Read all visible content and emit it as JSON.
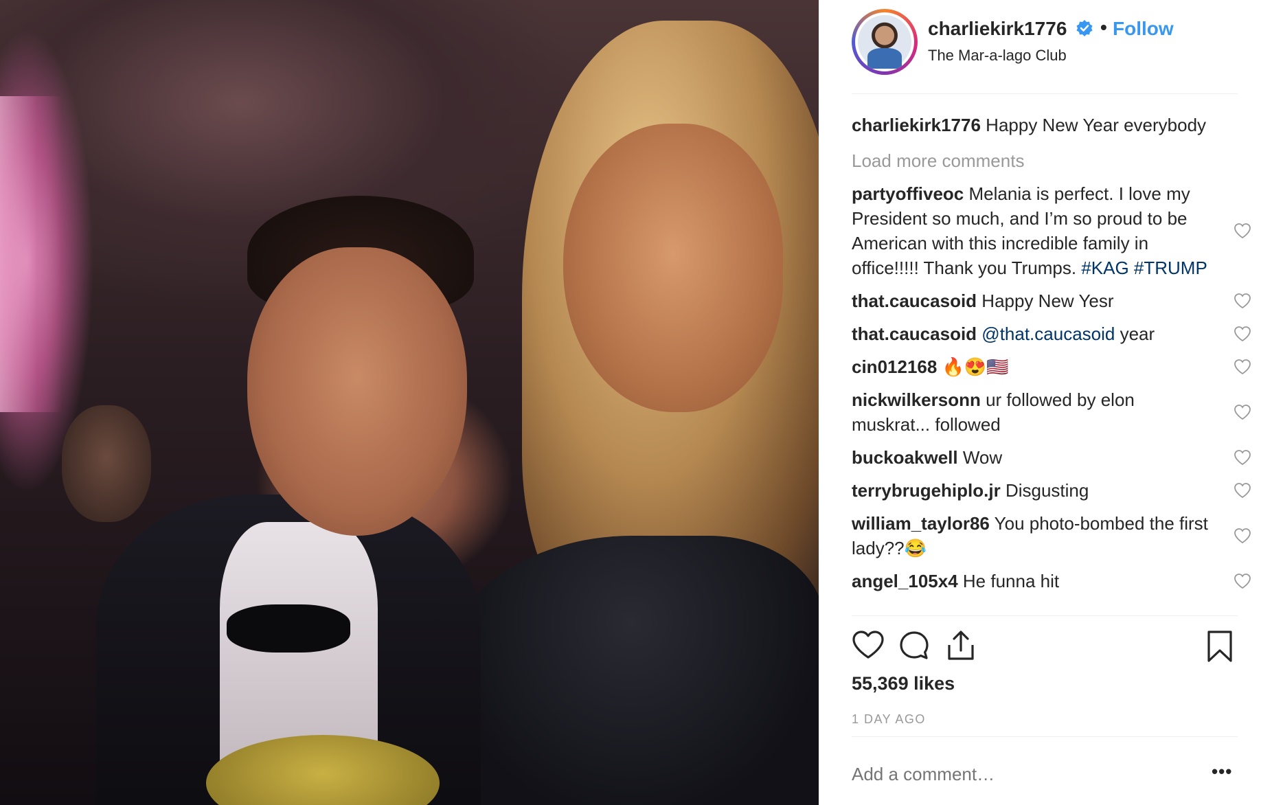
{
  "post": {
    "photo_alt": "",
    "header": {
      "username": "charliekirk1776",
      "dot": "•",
      "follow_label": "Follow",
      "location": "The Mar-a-lago Club"
    },
    "caption": {
      "username": "charliekirk1776",
      "text": "Happy New Year everybody"
    },
    "load_more_label": "Load more comments",
    "comments": [
      {
        "user": "partyoffiveoc",
        "text": "Melania is perfect. I love my President so much, and I’m so proud to be American with this incredible family in office!!!!! Thank you Trumps. ",
        "tags": "#KAG #TRUMP"
      },
      {
        "user": "that.caucasoid",
        "text": "Happy New Yesr",
        "tags": ""
      },
      {
        "user": "that.caucasoid",
        "mention": "@that.caucasoid",
        "text": " year",
        "tags": ""
      },
      {
        "user": "cin012168",
        "text": "🔥😍🇺🇸",
        "tags": ""
      },
      {
        "user": "nickwilkersonn",
        "text": "ur followed by elon muskrat... followed",
        "tags": ""
      },
      {
        "user": "buckoakwell",
        "text": "Wow",
        "tags": ""
      },
      {
        "user": "terrybrugehiplo.jr",
        "text": "Disgusting",
        "tags": ""
      },
      {
        "user": "william_taylor86",
        "text": "You photo-bombed the first lady??😂",
        "tags": ""
      },
      {
        "user": "angel_105x4",
        "text": "He funna hit",
        "tags": ""
      }
    ],
    "likes": "55,369 likes",
    "time": "1 DAY AGO",
    "add_comment_placeholder": "Add a comment…",
    "more_label": "•••",
    "colors": {
      "link": "#3897f0",
      "hashtag": "#003569",
      "muted": "#999999"
    },
    "icons": [
      "verified-icon",
      "heart-icon",
      "comment-icon",
      "share-icon",
      "bookmark-icon",
      "heart-small-icon",
      "more-icon"
    ]
  }
}
